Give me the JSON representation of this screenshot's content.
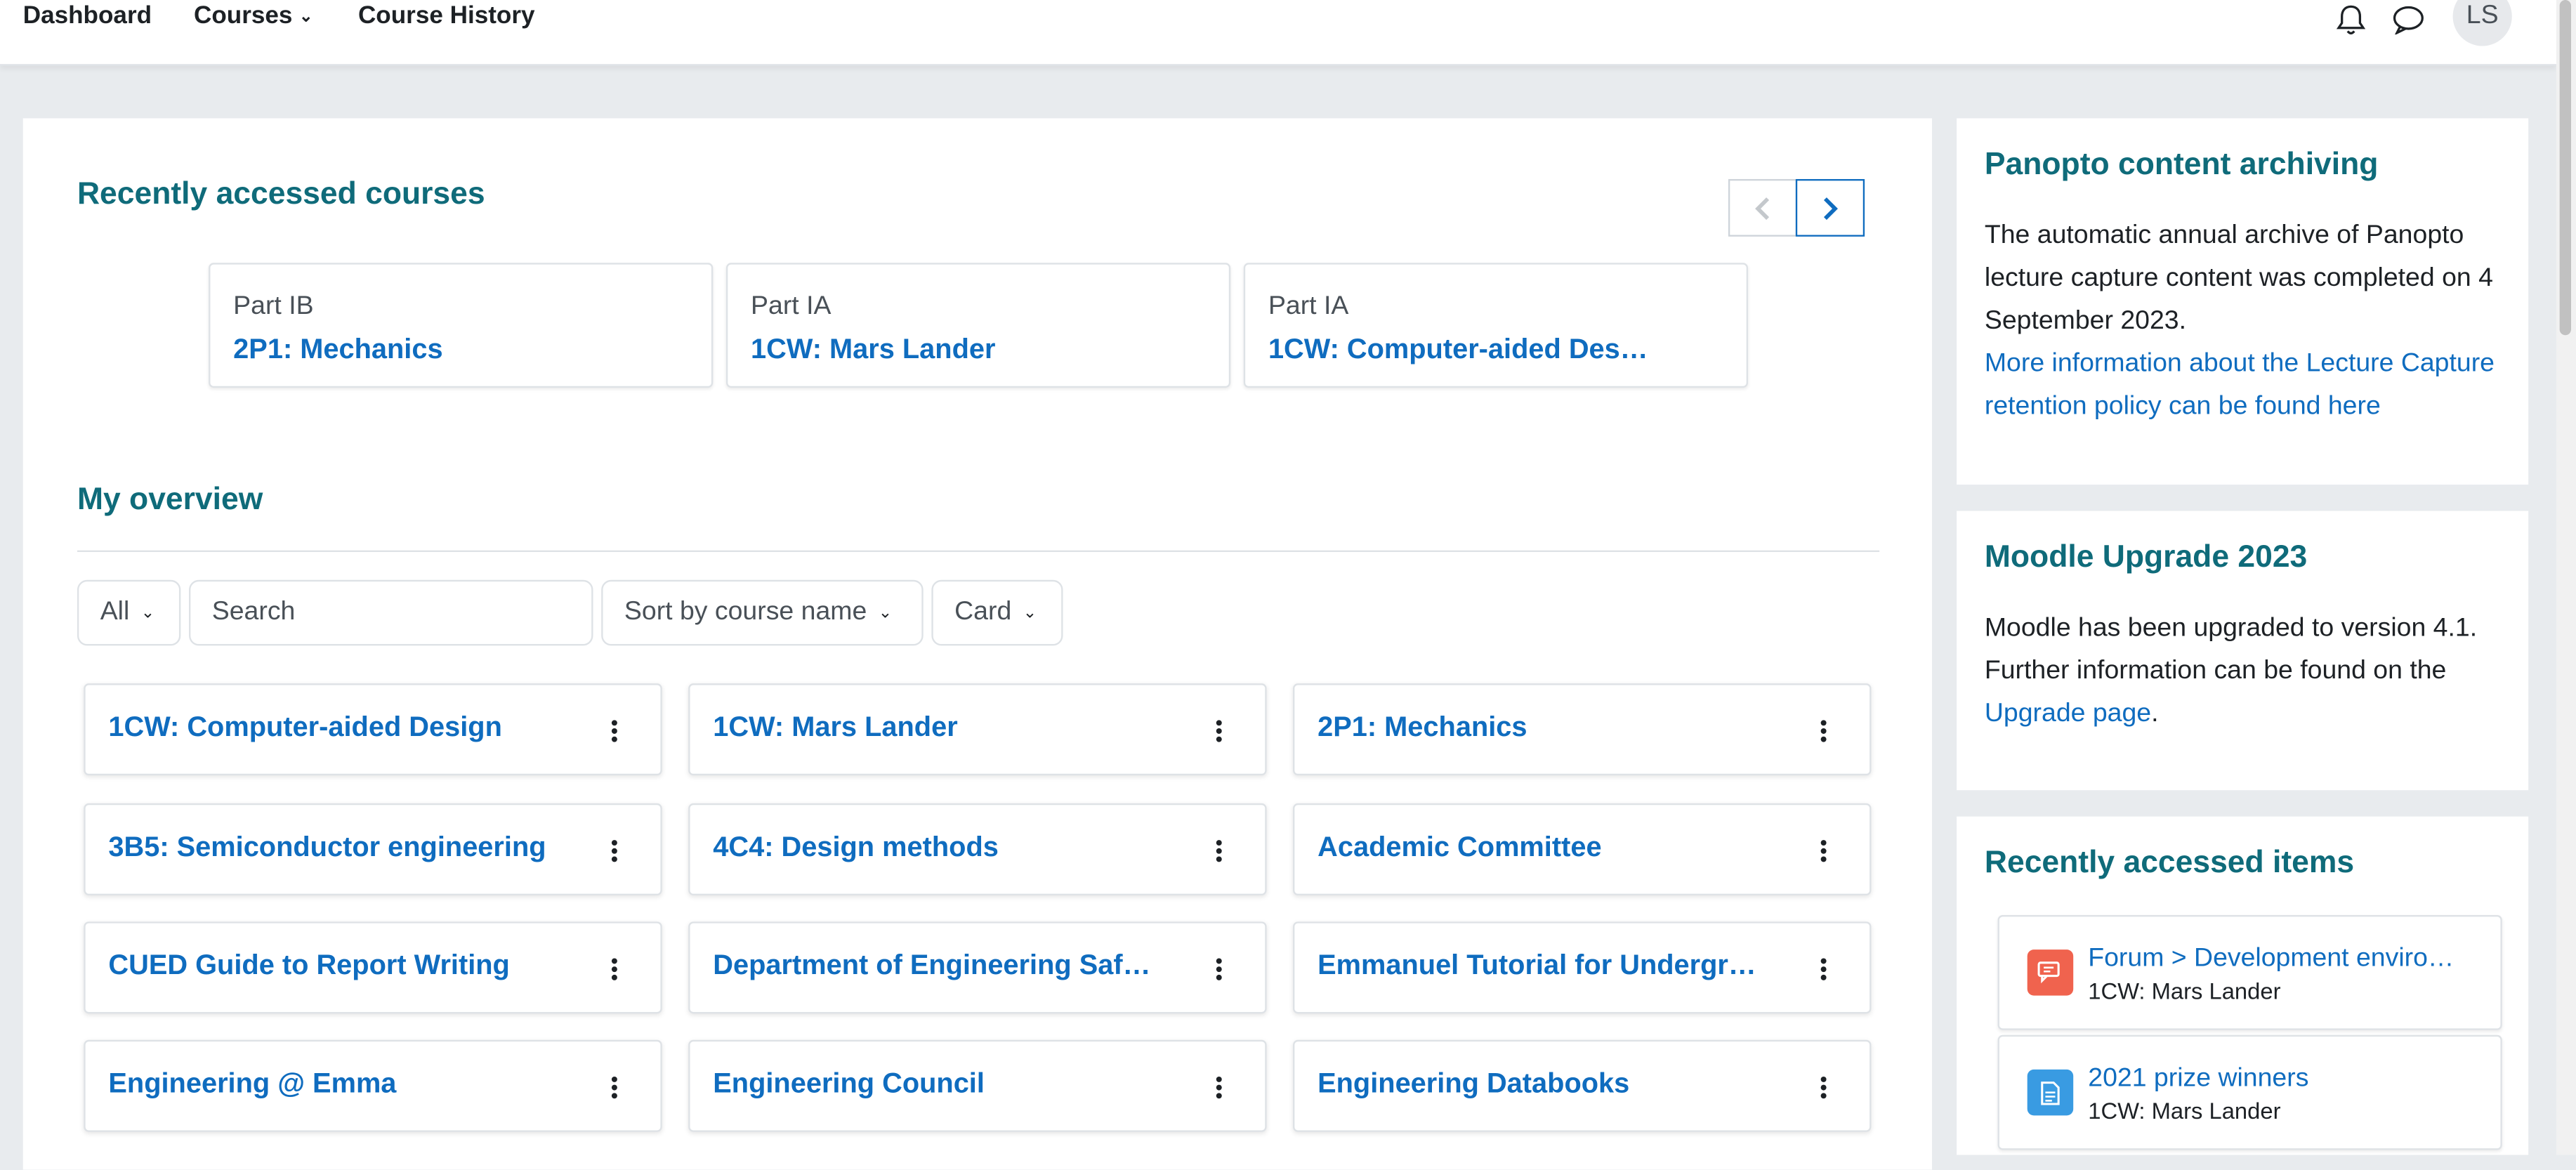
{
  "nav": {
    "dashboard": "Dashboard",
    "courses": "Courses",
    "course_history": "Course History",
    "avatar_initials": "LS"
  },
  "recent_courses": {
    "title": "Recently accessed courses",
    "cards": [
      {
        "category": "Part IB",
        "name": "2P1: Mechanics"
      },
      {
        "category": "Part IA",
        "name": "1CW: Mars Lander"
      },
      {
        "category": "Part IA",
        "name": "1CW: Computer-aided Des…"
      }
    ]
  },
  "overview": {
    "title": "My overview",
    "filter_value": "All",
    "search_placeholder": "Search",
    "sort_value": "Sort by course name",
    "view_value": "Card",
    "courses": [
      "1CW: Computer-aided Design",
      "1CW: Mars Lander",
      "2P1: Mechanics",
      "3B5: Semiconductor engineering",
      "4C4: Design methods",
      "Academic Committee",
      "CUED Guide to Report Writing",
      "Department of Engineering Saf…",
      "Emmanuel Tutorial for Undergr…",
      "Engineering @ Emma",
      "Engineering Council",
      "Engineering Databooks"
    ]
  },
  "panopto": {
    "title": "Panopto content archiving",
    "text": "The automatic annual archive of Panopto lecture capture content was completed on 4 September 2023.",
    "link": "More information about the Lecture Capture retention policy can be found here"
  },
  "moodle_upgrade": {
    "title": "Moodle Upgrade 2023",
    "text": "Moodle has been upgraded to version 4.1. Further information can be found on the",
    "link": "Upgrade page",
    "suffix": "."
  },
  "recent_items": {
    "title": "Recently accessed items",
    "items": [
      {
        "title": "Forum > Development enviro…",
        "course": "1CW: Mars Lander",
        "icon": "forum-icon",
        "color": "#f0634e"
      },
      {
        "title": "2021 prize winners",
        "course": "1CW: Mars Lander",
        "icon": "page-icon",
        "color": "#399be2"
      }
    ]
  },
  "colors": {
    "link": "#0f6cbf",
    "heading": "#0f6b7a",
    "background": "#e8ebee"
  }
}
